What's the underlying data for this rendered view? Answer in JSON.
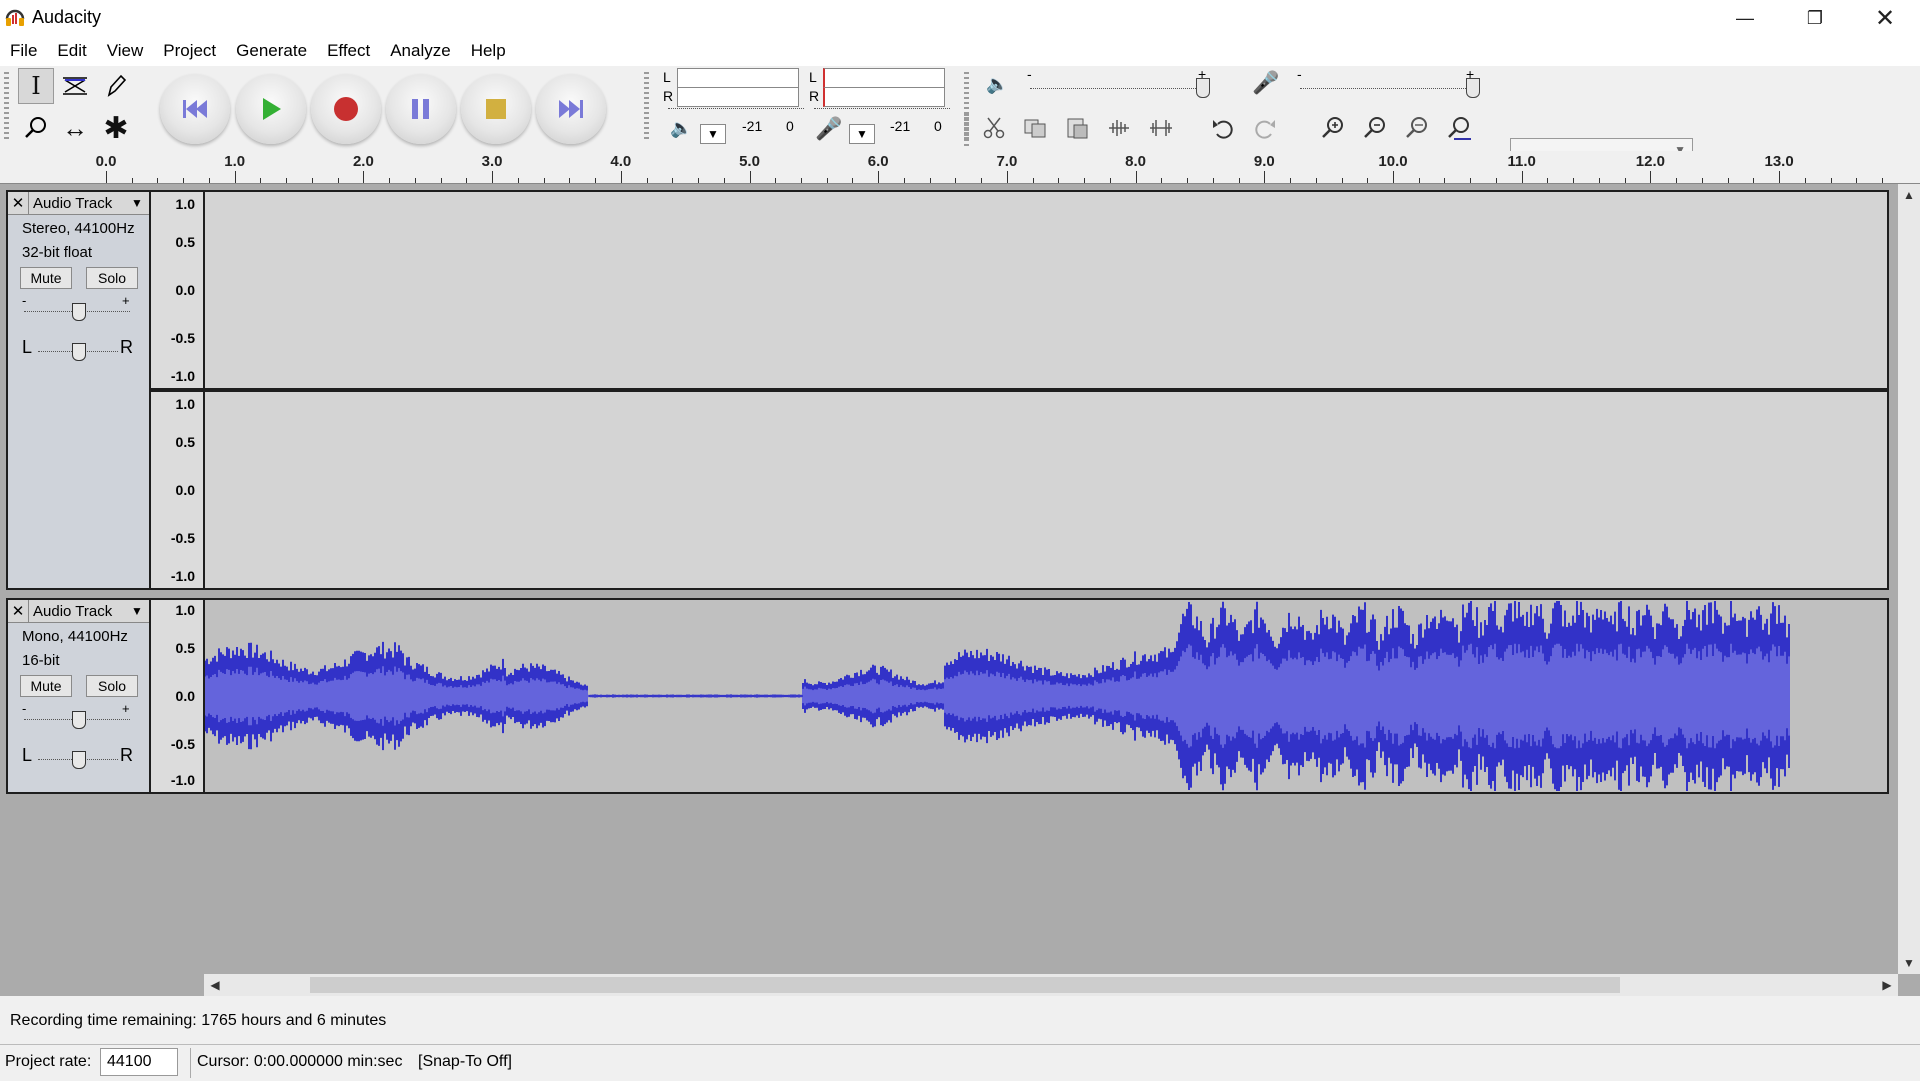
{
  "window": {
    "title": "Audacity"
  },
  "menu": [
    "File",
    "Edit",
    "View",
    "Project",
    "Generate",
    "Effect",
    "Analyze",
    "Help"
  ],
  "meters": {
    "play": {
      "l": "L",
      "r": "R",
      "scale_low": "-21",
      "scale_high": "0"
    },
    "record": {
      "l": "L",
      "r": "R",
      "scale_low": "-21",
      "scale_high": "0"
    }
  },
  "slider_marks": {
    "minus": "-",
    "plus": "+"
  },
  "ruler": {
    "ticks": [
      "0.0",
      "1.0",
      "2.0",
      "3.0",
      "4.0",
      "5.0",
      "6.0",
      "7.0",
      "8.0",
      "9.0",
      "10.0",
      "11.0",
      "12.0",
      "13.0"
    ]
  },
  "tracks": [
    {
      "name": "Audio Track",
      "format": "Stereo, 44100Hz",
      "depth": "32-bit float",
      "mute": "Mute",
      "solo": "Solo",
      "gain_minus": "-",
      "gain_plus": "+",
      "pan_l": "L",
      "pan_r": "R",
      "scale": [
        "1.0",
        "0.5",
        "0.0",
        "-0.5",
        "-1.0"
      ]
    },
    {
      "name": "Audio Track",
      "format": "Mono, 44100Hz",
      "depth": "16-bit",
      "mute": "Mute",
      "solo": "Solo",
      "gain_minus": "-",
      "gain_plus": "+",
      "pan_l": "L",
      "pan_r": "R",
      "scale": [
        "1.0",
        "0.5",
        "0.0",
        "-0.5",
        "-1.0"
      ]
    }
  ],
  "status": {
    "recording_time": "Recording time remaining: 1765 hours and 6 minutes",
    "project_rate_label": "Project rate:",
    "project_rate": "44100",
    "cursor": "Cursor: 0:00.000000 min:sec",
    "snap": "[Snap-To Off]"
  },
  "colors": {
    "waveform": "#3232c8",
    "waveform_rms": "#6464dc",
    "track_bg": "#c0c0c0"
  }
}
